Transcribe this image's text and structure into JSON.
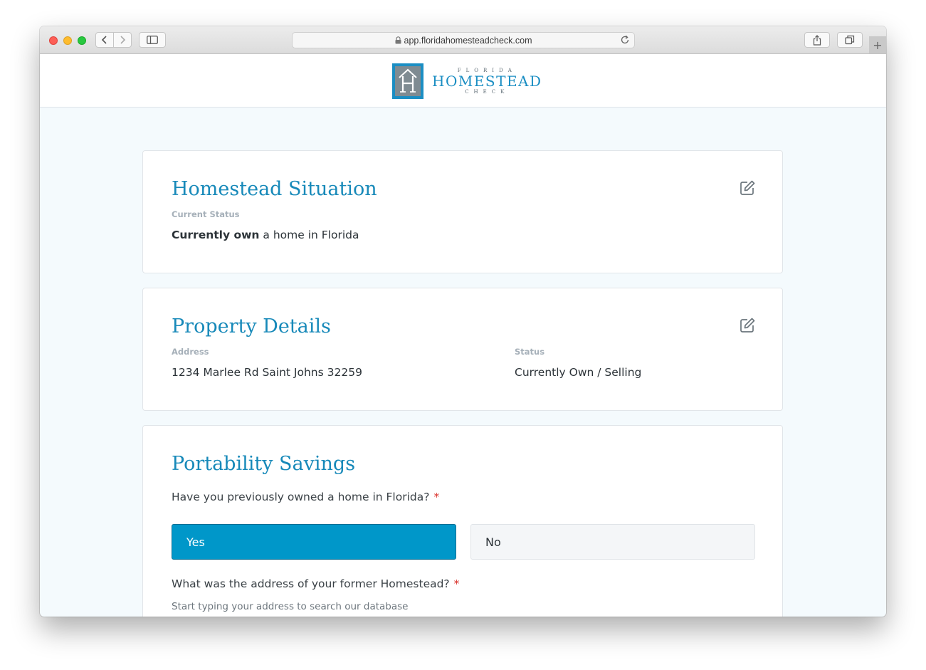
{
  "browser": {
    "url": "app.floridahomesteadcheck.com",
    "icons": [
      "back-icon",
      "forward-icon",
      "sidebar-icon",
      "lock-icon",
      "reload-icon",
      "share-icon",
      "tabs-icon",
      "new-tab-icon"
    ]
  },
  "logo": {
    "line1": "FLORIDA",
    "line2": "HOMESTEAD",
    "line3": "CHECK"
  },
  "homestead_situation": {
    "title": "Homestead Situation",
    "label": "Current Status",
    "value_bold": "Currently own",
    "value_rest": " a home in Florida"
  },
  "property_details": {
    "title": "Property Details",
    "address_label": "Address",
    "address_value": "1234 Marlee Rd Saint Johns 32259",
    "status_label": "Status",
    "status_value": "Currently Own / Selling"
  },
  "portability": {
    "title": "Portability Savings",
    "question1": "Have you previously owned a home in Florida?",
    "required_mark": "*",
    "yes_label": "Yes",
    "no_label": "No",
    "selected": "Yes",
    "question2": "What was the address of your former Homestead?",
    "hint": "Start typing your address to search our database"
  },
  "colors": {
    "accent": "#1789b9",
    "selected_button": "#0097c9",
    "required": "#d9322b",
    "page_bg": "#f4fafd"
  }
}
